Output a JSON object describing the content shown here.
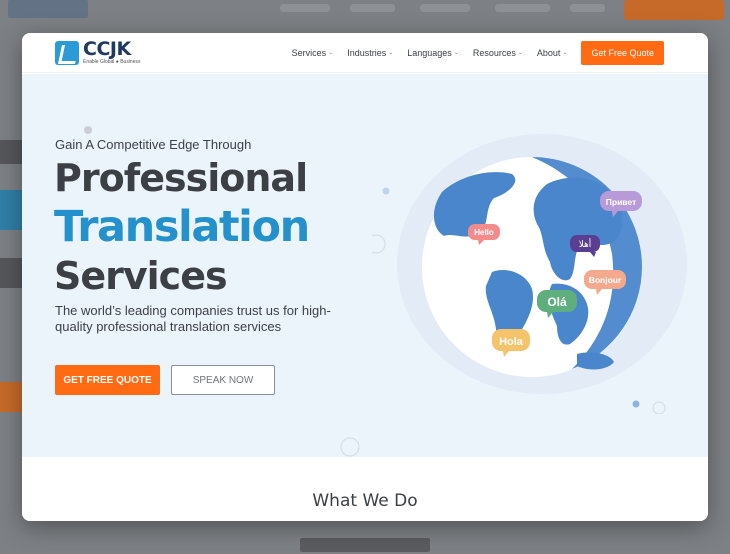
{
  "nav": {
    "logo_name": "CCJK",
    "logo_tag": "Enable Global ● Business",
    "items": [
      {
        "label": "Services"
      },
      {
        "label": "Industries"
      },
      {
        "label": "Languages"
      },
      {
        "label": "Resources"
      },
      {
        "label": "About"
      }
    ],
    "cta_label": "Get Free Quote"
  },
  "hero": {
    "eyebrow": "Gain A Competitive Edge Through",
    "line1": "Professional",
    "line2": "Translation",
    "line3": "Services",
    "subtitle": "The world’s leading companies trust us for high-quality professional translation services",
    "primary_button": "GET FREE QUOTE",
    "secondary_button": "SPEAK NOW"
  },
  "bubbles": {
    "hello": "Hello",
    "privet": "Привет",
    "arabic": "أهلا",
    "bonjour": "Bonjour",
    "ola": "Olá",
    "hola": "Hola"
  },
  "section2": {
    "title": "What We Do"
  },
  "colors": {
    "accent_orange": "#ff6a13",
    "brand_blue": "#2490cc",
    "heading_dark": "#3c3f44"
  }
}
